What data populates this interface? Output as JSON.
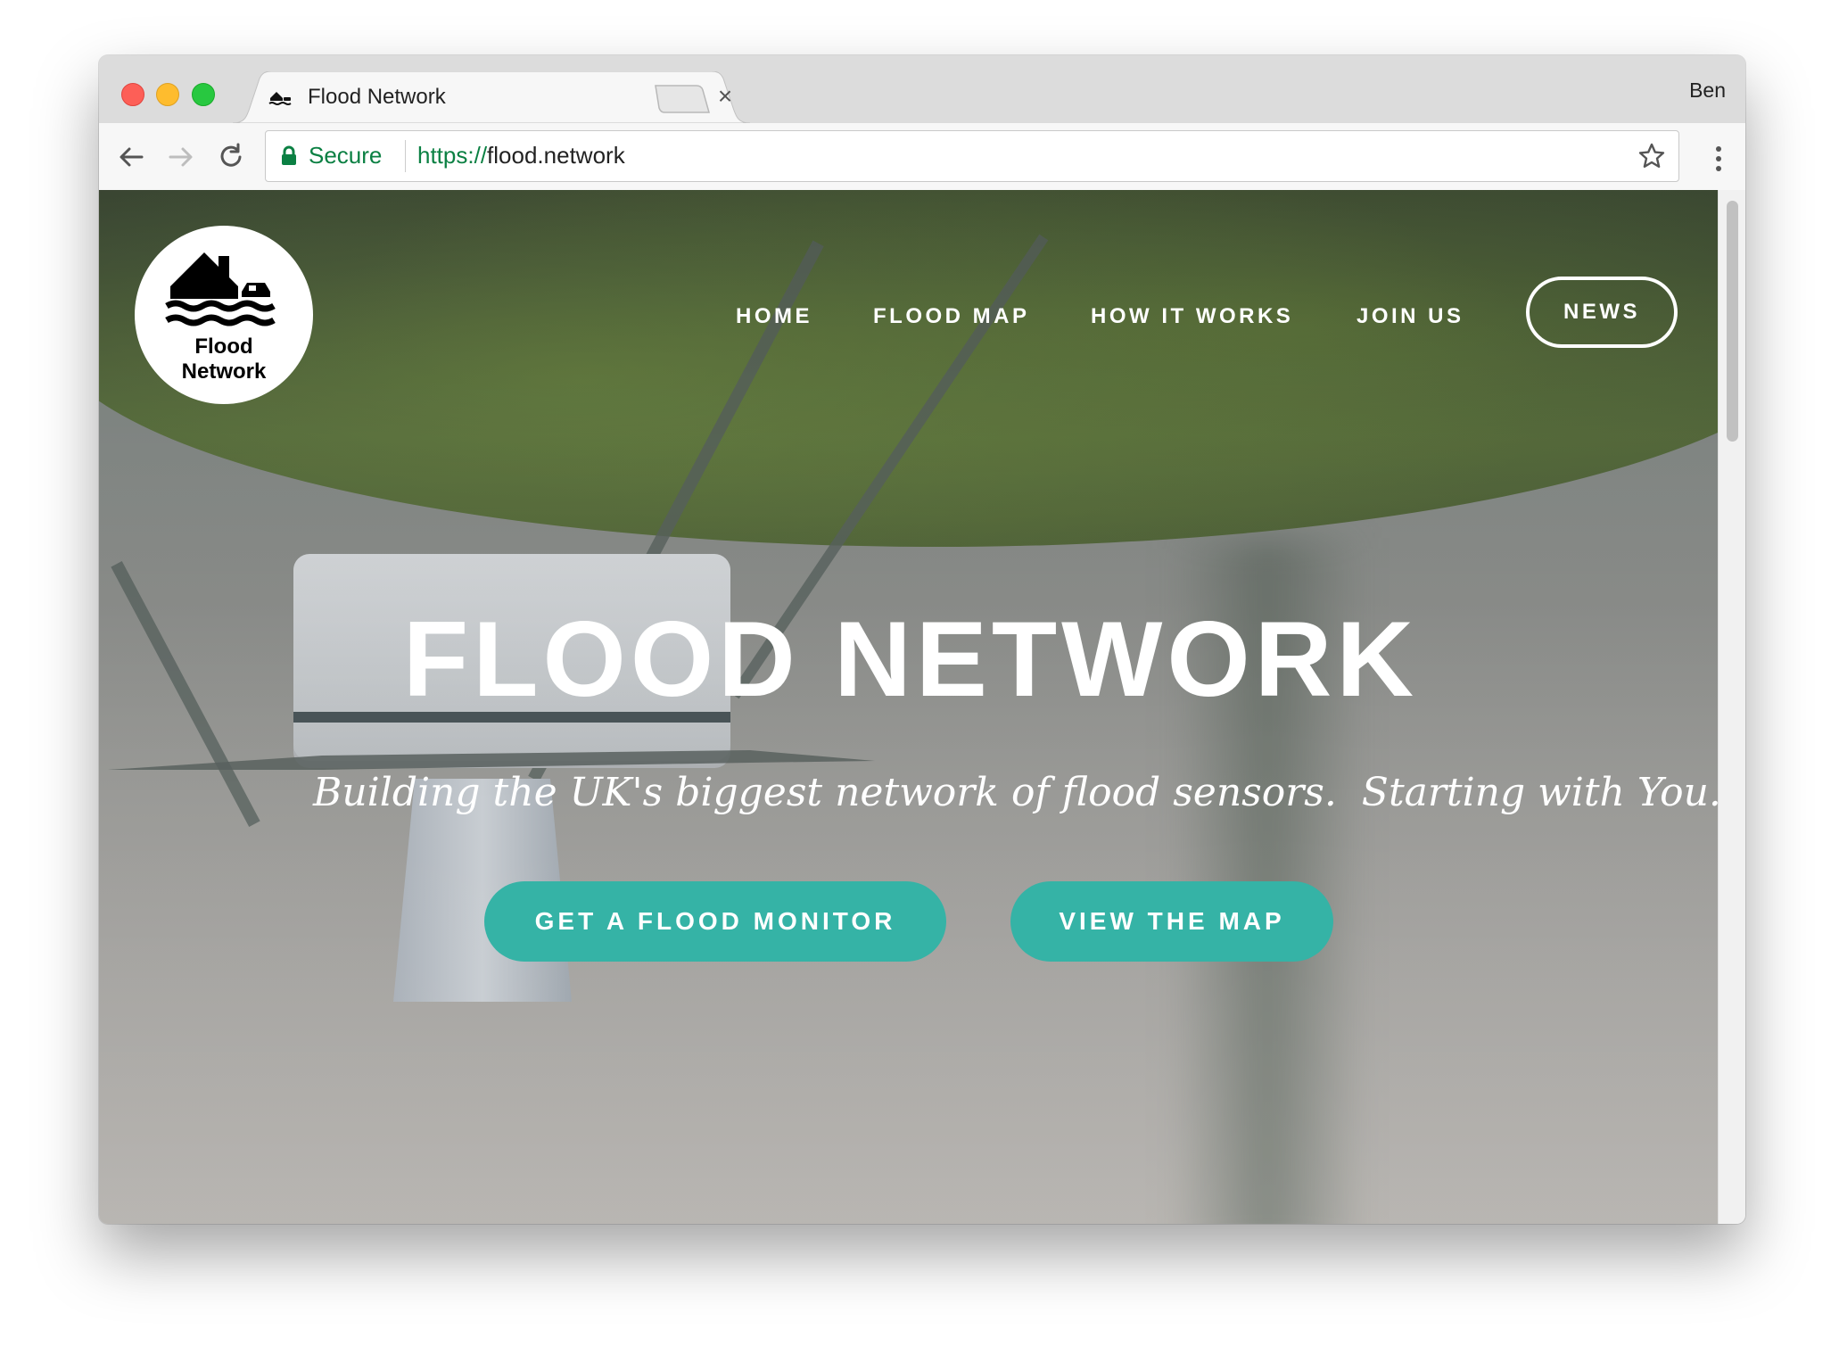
{
  "browser": {
    "tab_title": "Flood Network",
    "tab_close": "×",
    "profile": "Ben",
    "secure_label": "Secure",
    "url_scheme": "https://",
    "url_host": "flood.network"
  },
  "site": {
    "logo_line1": "Flood",
    "logo_line2": "Network",
    "nav": [
      "HOME",
      "FLOOD MAP",
      "HOW IT WORKS",
      "JOIN US"
    ],
    "nav_news": "NEWS",
    "hero_title": "FLOOD NETWORK",
    "hero_subtitle": "Building the UK's biggest network of flood sensors.  Starting with You.",
    "cta_primary": "GET A FLOOD MONITOR",
    "cta_secondary": "VIEW THE MAP"
  },
  "colors": {
    "accent": "#35b3a6",
    "secure_green": "#0b8043"
  }
}
